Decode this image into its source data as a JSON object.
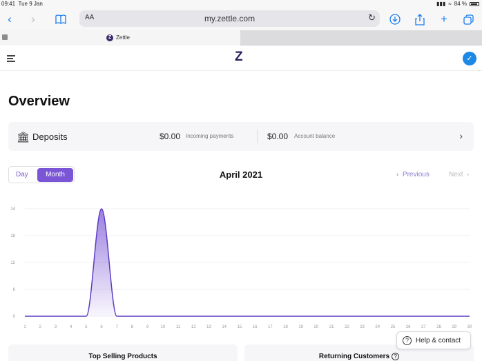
{
  "status_bar": {
    "time": "09:41",
    "date": "Tue 9 Jan",
    "battery": "84 %"
  },
  "browser": {
    "text_size_label": "AA",
    "url": "my.zettle.com",
    "tab_title": "Zettle",
    "tab_favicon_letter": "Z"
  },
  "app": {
    "logo": "Z",
    "page_title": "Overview",
    "deposits": {
      "label": "Deposits",
      "incoming_value": "$0.00",
      "incoming_label": "Incoming payments",
      "balance_value": "$0.00",
      "balance_label": "Account balance"
    },
    "period_toggle": {
      "day": "Day",
      "month": "Month",
      "selected": "Month"
    },
    "period_title": "April 2021",
    "nav": {
      "previous": "Previous",
      "next": "Next"
    },
    "cards": {
      "top_products": "Top Selling Products",
      "returning_customers": "Returning Customers"
    },
    "help": "Help & contact"
  },
  "colors": {
    "accent": "#7a55d6",
    "brand": "#2b1f5c",
    "avatar": "#1e88e5"
  },
  "chart_data": {
    "type": "area",
    "x": [
      1,
      2,
      3,
      4,
      5,
      6,
      7,
      8,
      9,
      10,
      11,
      12,
      13,
      14,
      15,
      16,
      17,
      18,
      19,
      20,
      21,
      22,
      23,
      24,
      25,
      26,
      27,
      28,
      29,
      30
    ],
    "series": [
      {
        "values": [
          0,
          0,
          0,
          0,
          0,
          24,
          0,
          0,
          0,
          0,
          0,
          0,
          0,
          0,
          0,
          0,
          0,
          0,
          0,
          0,
          0,
          0,
          0,
          0,
          0,
          0,
          0,
          0,
          0,
          0
        ]
      }
    ],
    "y_ticks": [
      0,
      6,
      12,
      18,
      24
    ],
    "ylim": [
      0,
      24
    ],
    "grid": true
  }
}
